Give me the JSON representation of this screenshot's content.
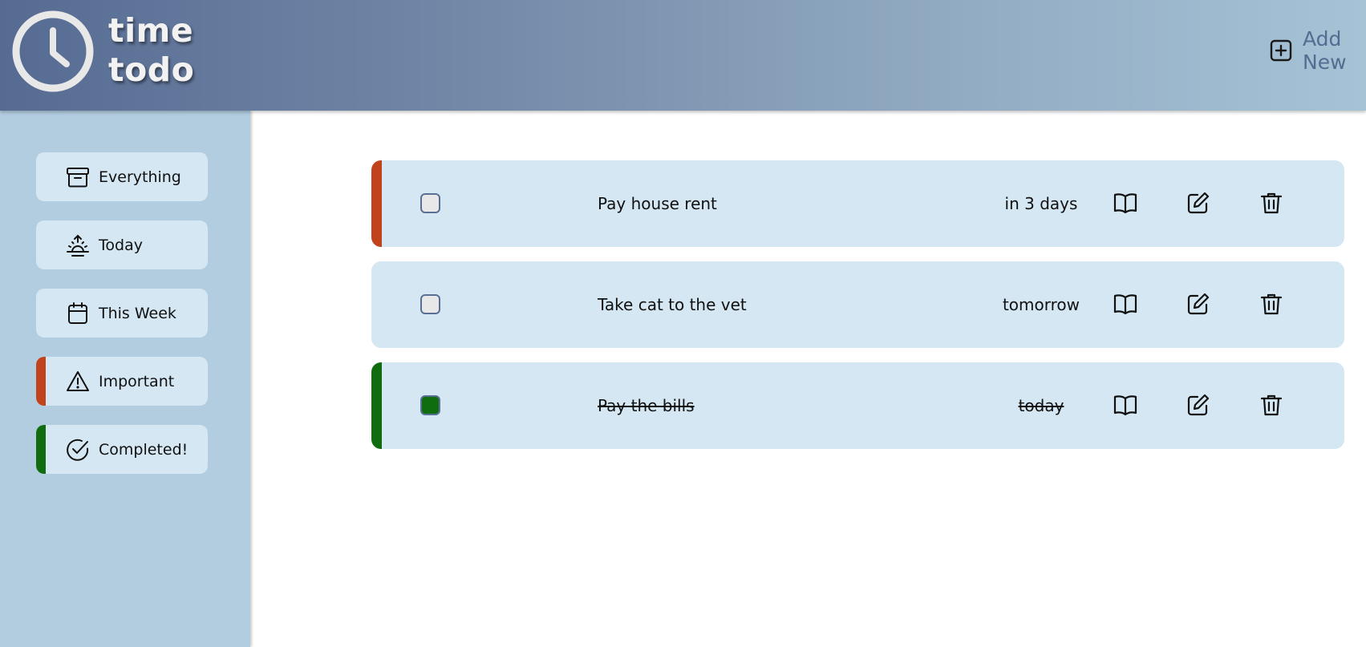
{
  "header": {
    "logo_line1": "time",
    "logo_line2": "todo",
    "logo_icon": "clock-icon",
    "add_new_label": "Add New",
    "add_new_icon": "plus-square-icon"
  },
  "sidebar": {
    "items": [
      {
        "label": "Everything",
        "icon": "archive-box-icon",
        "accent": null
      },
      {
        "label": "Today",
        "icon": "sunrise-icon",
        "accent": null
      },
      {
        "label": "This Week",
        "icon": "calendar-icon",
        "accent": null
      },
      {
        "label": "Important",
        "icon": "warning-triangle-icon",
        "accent": "#c0431c"
      },
      {
        "label": "Completed!",
        "icon": "check-circle-icon",
        "accent": "#0f6d0f"
      }
    ]
  },
  "todos": [
    {
      "title": "Pay house rent",
      "due": "in 3 days",
      "completed": false,
      "accent": "#c0431c"
    },
    {
      "title": "Take cat to the vet",
      "due": "tomorrow",
      "completed": false,
      "accent": null
    },
    {
      "title": "Pay the bills",
      "due": "today",
      "completed": true,
      "accent": "#0f6d0f"
    }
  ],
  "row_actions": [
    "details-book-icon",
    "edit-icon",
    "delete-trash-icon"
  ],
  "colors": {
    "header_start": "#566b92",
    "header_end": "#a6c3d6",
    "sidebar_bg": "#b1cddf",
    "card_bg": "#d4e7f2",
    "important": "#c0431c",
    "completed": "#0f6d0f"
  }
}
